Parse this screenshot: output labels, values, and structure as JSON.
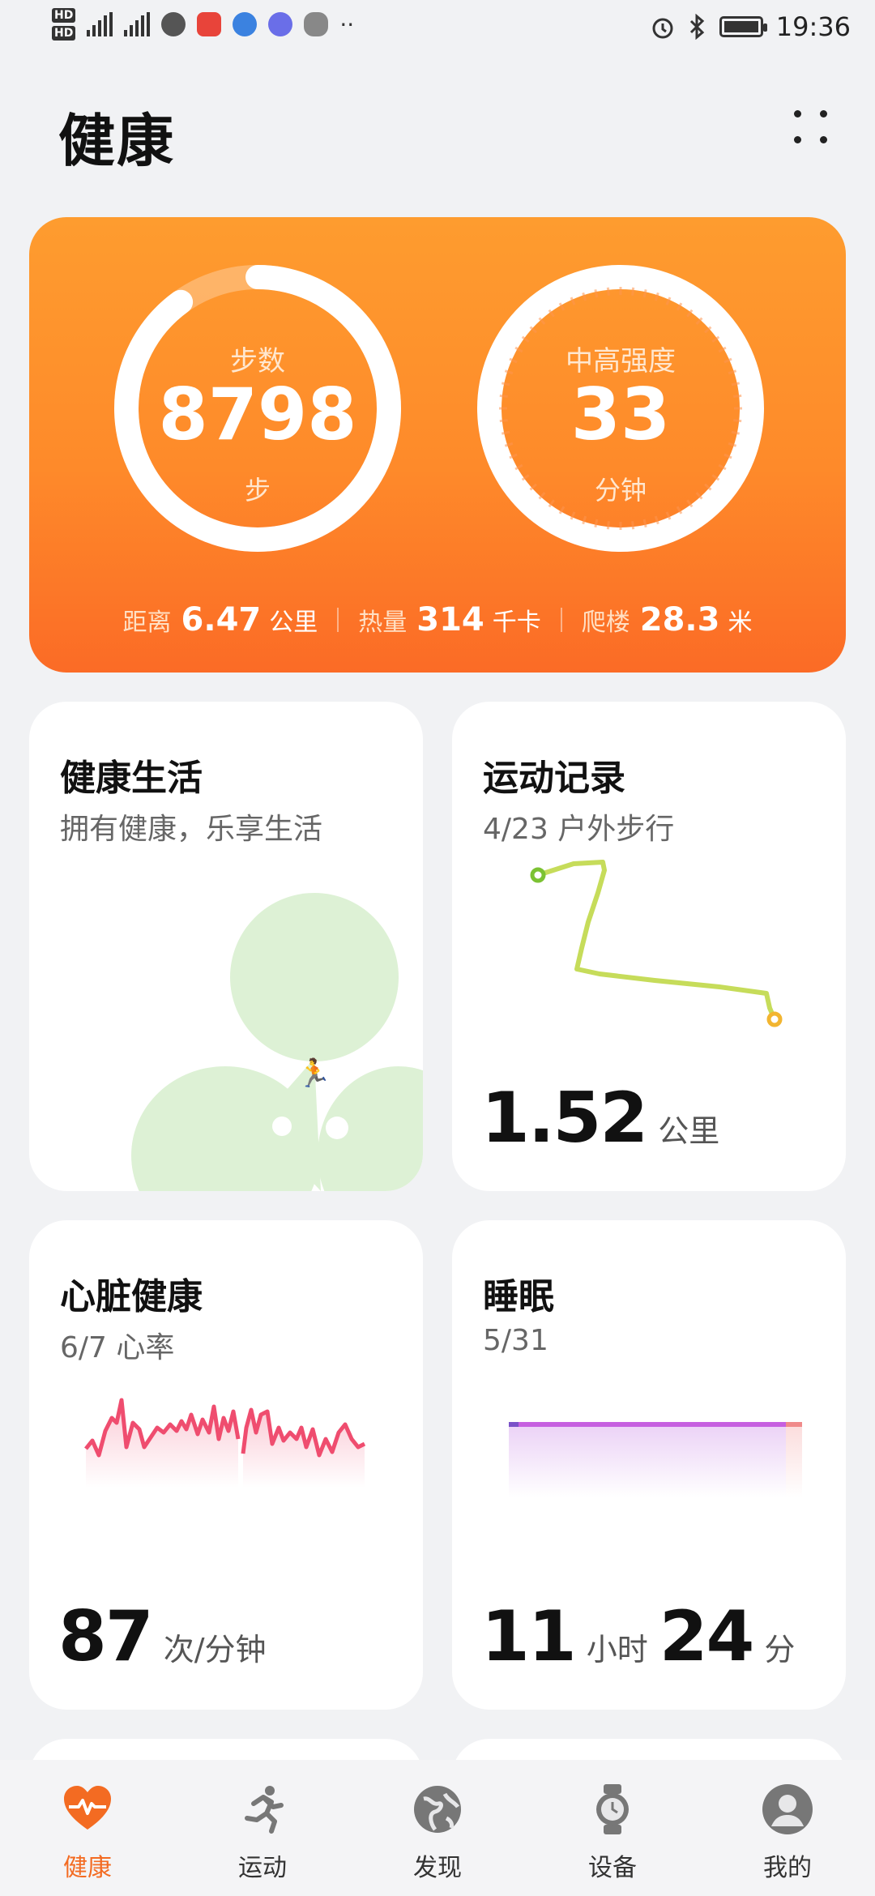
{
  "status_bar": {
    "time": "19:36",
    "network": "4G",
    "hd_badges": [
      "HD1",
      "HD2"
    ]
  },
  "header": {
    "title": "健康"
  },
  "hero": {
    "steps": {
      "label": "步数",
      "value": "8798",
      "unit": "步",
      "progress": 0.9
    },
    "intensity": {
      "label": "中高强度",
      "value": "33",
      "unit": "分钟"
    },
    "distance": {
      "label": "距离",
      "value": "6.47",
      "unit": "公里"
    },
    "calories": {
      "label": "热量",
      "value": "314",
      "unit": "千卡"
    },
    "floors": {
      "label": "爬楼",
      "value": "28.3",
      "unit": "米"
    },
    "colors": {
      "top": "#fe9c2f",
      "bottom": "#fb6b26"
    }
  },
  "cards": {
    "healthy_life": {
      "title": "健康生活",
      "subtitle": "拥有健康，乐享生活"
    },
    "exercise": {
      "title": "运动记录",
      "subtitle": "4/23 户外步行",
      "value": "1.52",
      "unit": "公里"
    },
    "heart": {
      "title": "心脏健康",
      "subtitle": "6/7 心率",
      "value": "87",
      "unit": "次/分钟"
    },
    "sleep": {
      "title": "睡眠",
      "subtitle": "5/31",
      "hours": "11",
      "hours_unit": "小时",
      "minutes": "24",
      "minutes_unit": "分"
    }
  },
  "nav": {
    "items": [
      {
        "label": "健康",
        "icon": "heart-pulse-icon",
        "active": true
      },
      {
        "label": "运动",
        "icon": "running-icon",
        "active": false
      },
      {
        "label": "发现",
        "icon": "globe-icon",
        "active": false
      },
      {
        "label": "设备",
        "icon": "watch-icon",
        "active": false
      },
      {
        "label": "我的",
        "icon": "person-icon",
        "active": false
      }
    ]
  }
}
